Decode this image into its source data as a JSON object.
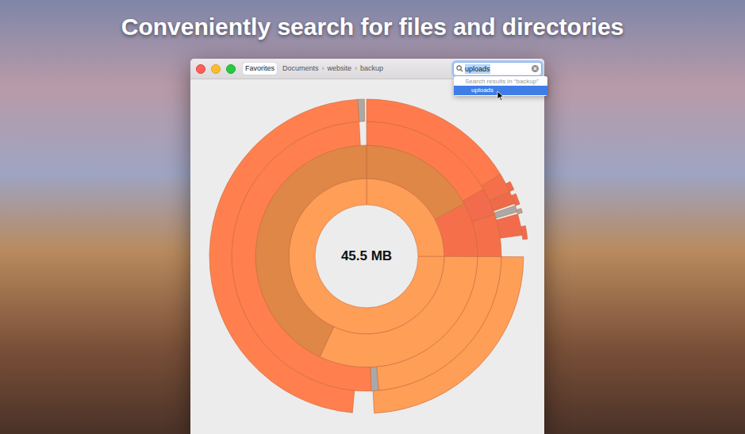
{
  "banner": {
    "title": "Conveniently search for files and directories"
  },
  "toolbar": {
    "favorites": "Favorites",
    "breadcrumbs": [
      {
        "label": "Documents",
        "kind": "crumb"
      },
      {
        "label": "›",
        "kind": "separator"
      },
      {
        "label": "website",
        "kind": "crumb"
      },
      {
        "label": "›",
        "kind": "separator"
      },
      {
        "label": "backup",
        "kind": "crumb"
      }
    ]
  },
  "search": {
    "value": "uploads",
    "text_selected": true
  },
  "dropdown": {
    "header": "Search results in “backup”",
    "items": [
      {
        "label": "uploads",
        "selected": true
      }
    ]
  },
  "chart": {
    "total": "45.5 MB",
    "total_value": 45.5,
    "rings": [
      {
        "segments": [
          {
            "start": 0,
            "size": 11.4,
            "color": "#ff9e57"
          },
          {
            "start": 11.4,
            "size": 34.1,
            "color": "#ff9e57"
          }
        ]
      },
      {
        "segments": [
          {
            "start": 0,
            "size": 7.8,
            "color": "#de8746"
          },
          {
            "start": 7.8,
            "size": 3.6,
            "color": "#f5704a"
          },
          {
            "start": 11.4,
            "size": 14.5,
            "color": "#ff9e57"
          },
          {
            "start": 25.9,
            "size": 19.6,
            "color": "#de8746"
          }
        ]
      },
      {
        "segments": [
          {
            "start": 0,
            "size": 7.6,
            "color": "#ff7b4d"
          },
          {
            "start": 7.6,
            "size": 1.5,
            "color": "#f26b4c"
          },
          {
            "start": 9.1,
            "size": 2.3,
            "color": "#f5704a"
          },
          {
            "start": 11.4,
            "size": 10.7,
            "color": "#ff9e57"
          },
          {
            "start": 22.1,
            "size": 0.4,
            "color": "#a9a9a9"
          },
          {
            "start": 22.5,
            "size": 22.6,
            "color": "#ff804e"
          }
        ]
      },
      {
        "segments": [
          {
            "start": 0,
            "size": 7.4,
            "color": "#ff7b4d"
          },
          {
            "start": 7.4,
            "size": 0.9,
            "color": "#f5704a"
          },
          {
            "start": 8.3,
            "size": 0.6,
            "color": "#ee6a48"
          },
          {
            "start": 9.0,
            "size": 0.3,
            "color": "#a9a9a9"
          },
          {
            "start": 9.4,
            "size": 1.0,
            "color": "#f26b4c"
          },
          {
            "start": 11.4,
            "size": 11.0,
            "color": "#ff9e57"
          },
          {
            "start": 23.4,
            "size": 21.7,
            "color": "#ff804e"
          },
          {
            "start": 45.1,
            "size": 0.3,
            "color": "#a9a9a9"
          }
        ]
      },
      {
        "segments": [
          {
            "start": 7.9,
            "size": 0.4,
            "color": "#f26b4c"
          },
          {
            "start": 8.5,
            "size": 0.5,
            "color": "#f26b4c"
          },
          {
            "start": 9.2,
            "size": 0.2,
            "color": "#a9a9a9"
          },
          {
            "start": 10.0,
            "size": 0.6,
            "color": "#f26b4c"
          }
        ]
      }
    ]
  }
}
